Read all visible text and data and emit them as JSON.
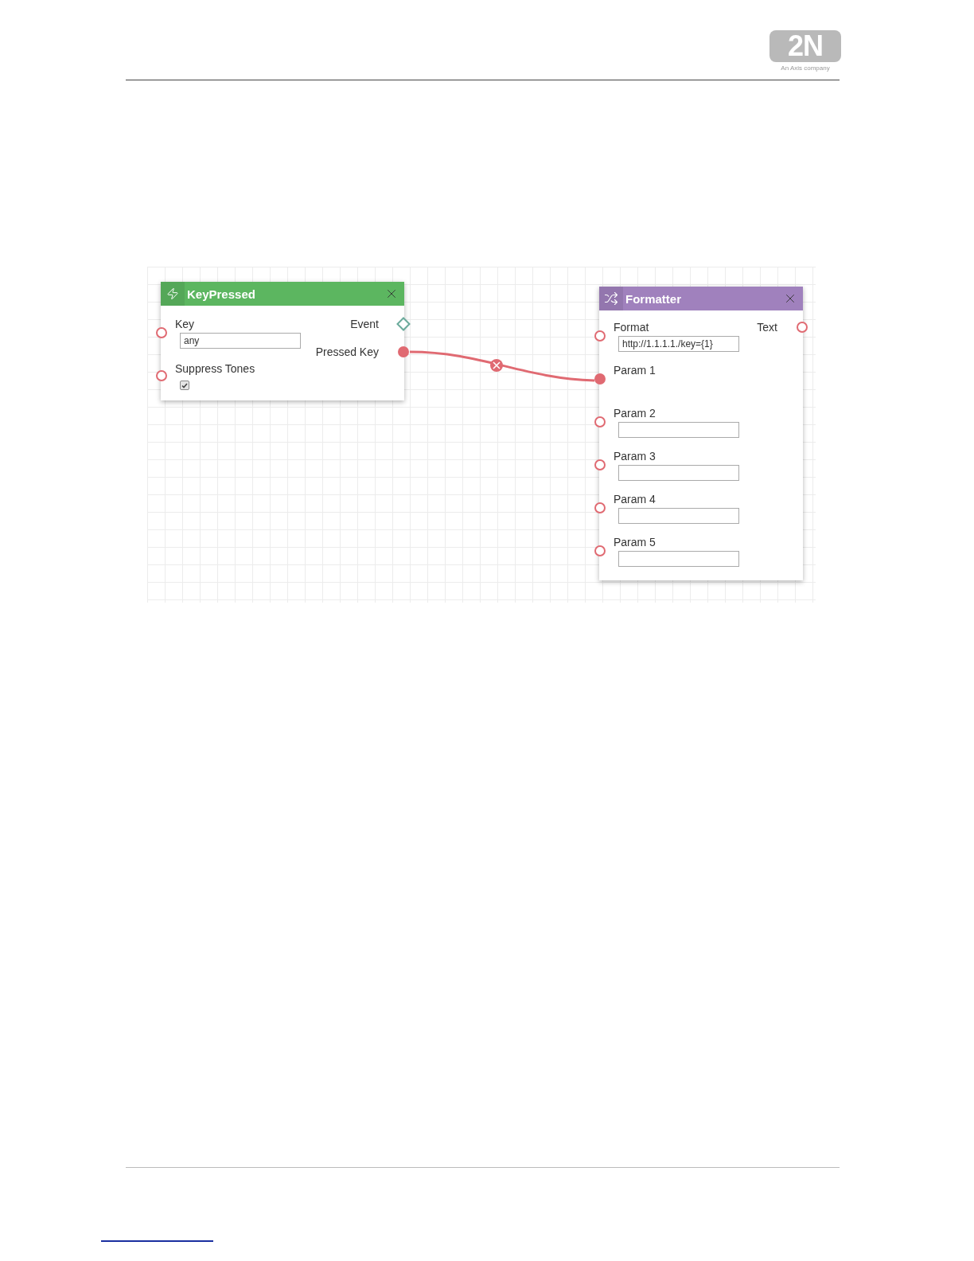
{
  "header": {
    "logo": {
      "mark": "2N",
      "tagline": "An Axis company"
    }
  },
  "canvas": {
    "nodes": [
      {
        "kind": "event",
        "title": "KeyPressed",
        "color": "#5cb660",
        "inputs": [
          {
            "kind": "field",
            "label": "Key",
            "value": "any",
            "connected": false
          },
          {
            "kind": "checkbox",
            "label": "Suppress Tones",
            "checked": true,
            "connected": false
          }
        ],
        "outputs": [
          {
            "kind": "diamond",
            "label": "Event",
            "connected": false
          },
          {
            "kind": "circle",
            "label": "Pressed Key",
            "connected": true
          }
        ]
      },
      {
        "kind": "function",
        "title": "Formatter",
        "color": "#a081bd",
        "inputs": [
          {
            "kind": "field",
            "label": "Format",
            "value": "http://1.1.1.1./key={1}",
            "connected": false
          },
          {
            "kind": "field",
            "label": "Param 1",
            "connected": true
          },
          {
            "kind": "field",
            "label": "Param 2",
            "connected": false
          },
          {
            "kind": "field",
            "label": "Param 3",
            "connected": false
          },
          {
            "kind": "field",
            "label": "Param 4",
            "connected": false
          },
          {
            "kind": "field",
            "label": "Param 5",
            "connected": false
          }
        ],
        "outputs": [
          {
            "kind": "circle",
            "label": "Text",
            "connected": false
          }
        ]
      }
    ]
  }
}
